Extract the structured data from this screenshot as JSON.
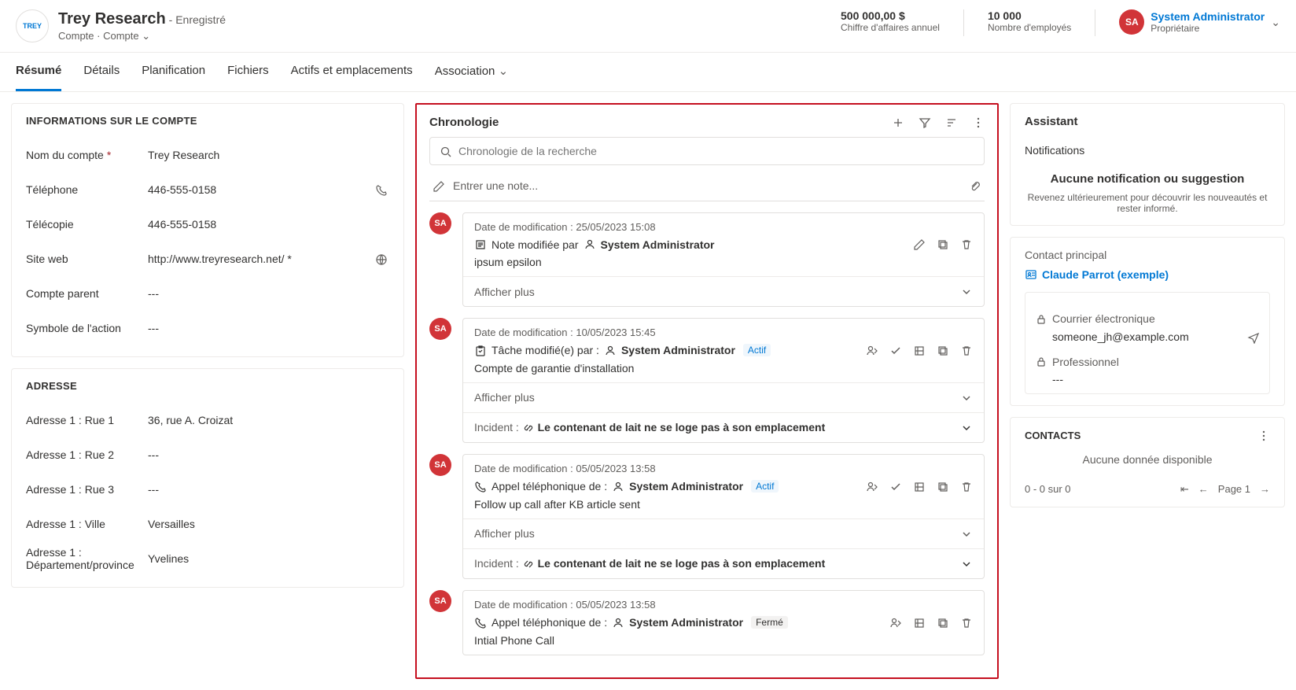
{
  "header": {
    "company": "Trey Research",
    "saved": "- Enregistré",
    "subtitle": "Compte  ·  Compte",
    "revenue_value": "500 000,00 $",
    "revenue_label": "Chiffre d'affaires annuel",
    "employees_value": "10 000",
    "employees_label": "Nombre d'employés",
    "owner_initials": "SA",
    "owner_name": "System Administrator",
    "owner_role": "Propriétaire"
  },
  "tabs": {
    "t0": "Résumé",
    "t1": "Détails",
    "t2": "Planification",
    "t3": "Fichiers",
    "t4": "Actifs et emplacements",
    "t5": "Association"
  },
  "account_info": {
    "title": "INFORMATIONS SUR LE COMPTE",
    "name_label": "Nom du compte",
    "name_value": "Trey Research",
    "phone_label": "Téléphone",
    "phone_value": "446-555-0158",
    "fax_label": "Télécopie",
    "fax_value": "446-555-0158",
    "web_label": "Site web",
    "web_value": "http://www.treyresearch.net/ *",
    "parent_label": "Compte parent",
    "parent_value": "---",
    "ticker_label": "Symbole de l'action",
    "ticker_value": "---"
  },
  "address": {
    "title": "ADRESSE",
    "street1_label": "Adresse 1 : Rue 1",
    "street1_value": "36, rue A. Croizat",
    "street2_label": "Adresse 1 : Rue 2",
    "street2_value": "---",
    "street3_label": "Adresse 1 : Rue 3",
    "street3_value": "---",
    "city_label": "Adresse 1 : Ville",
    "city_value": "Versailles",
    "state_label": "Adresse 1 : Département/province",
    "state_value": "Yvelines"
  },
  "timeline": {
    "title": "Chronologie",
    "search_placeholder": "Chronologie de la recherche",
    "note_placeholder": "Entrer une note...",
    "show_more": "Afficher plus",
    "incident_label": "Incident :",
    "items": [
      {
        "initials": "SA",
        "date": "Date de modification : 25/05/2023 15:08",
        "action": "Note modifiée par",
        "by": "System Administrator",
        "desc": "ipsum epsilon",
        "status": "",
        "actions": [
          "edit",
          "copy",
          "delete"
        ],
        "show_more": true,
        "incident": ""
      },
      {
        "initials": "SA",
        "date": "Date de modification : 10/05/2023 15:45",
        "action": "Tâche modifié(e) par :",
        "by": "System Administrator",
        "desc": "Compte de garantie d'installation",
        "status": "Actif",
        "actions": [
          "assign",
          "check",
          "open",
          "copy",
          "delete"
        ],
        "show_more": true,
        "incident": "Le contenant de lait ne se loge pas à son emplacement"
      },
      {
        "initials": "SA",
        "date": "Date de modification : 05/05/2023 13:58",
        "action": "Appel téléphonique de :",
        "by": "System Administrator",
        "desc": "Follow up call after KB article sent",
        "status": "Actif",
        "actions": [
          "assign",
          "check",
          "open",
          "copy",
          "delete"
        ],
        "show_more": true,
        "incident": "Le contenant de lait ne se loge pas à son emplacement"
      },
      {
        "initials": "SA",
        "date": "Date de modification : 05/05/2023 13:58",
        "action": "Appel téléphonique de :",
        "by": "System Administrator",
        "desc": "Intial Phone Call",
        "status": "Fermé",
        "actions": [
          "assign",
          "open",
          "copy",
          "delete"
        ],
        "show_more": false,
        "incident": ""
      }
    ]
  },
  "assistant": {
    "title": "Assistant",
    "notif_title": "Notifications",
    "no_notif": "Aucune notification ou suggestion",
    "no_notif_sub": "Revenez ultérieurement pour découvrir les nouveautés et rester informé."
  },
  "contact": {
    "title": "Contact principal",
    "name": "Claude Parrot (exemple)",
    "email_label": "Courrier électronique",
    "email_value": "someone_jh@example.com",
    "pro_label": "Professionnel",
    "pro_value": "---"
  },
  "contacts_section": {
    "title": "CONTACTS",
    "no_data": "Aucune donnée disponible",
    "range": "0 - 0 sur 0",
    "page": "Page 1"
  }
}
